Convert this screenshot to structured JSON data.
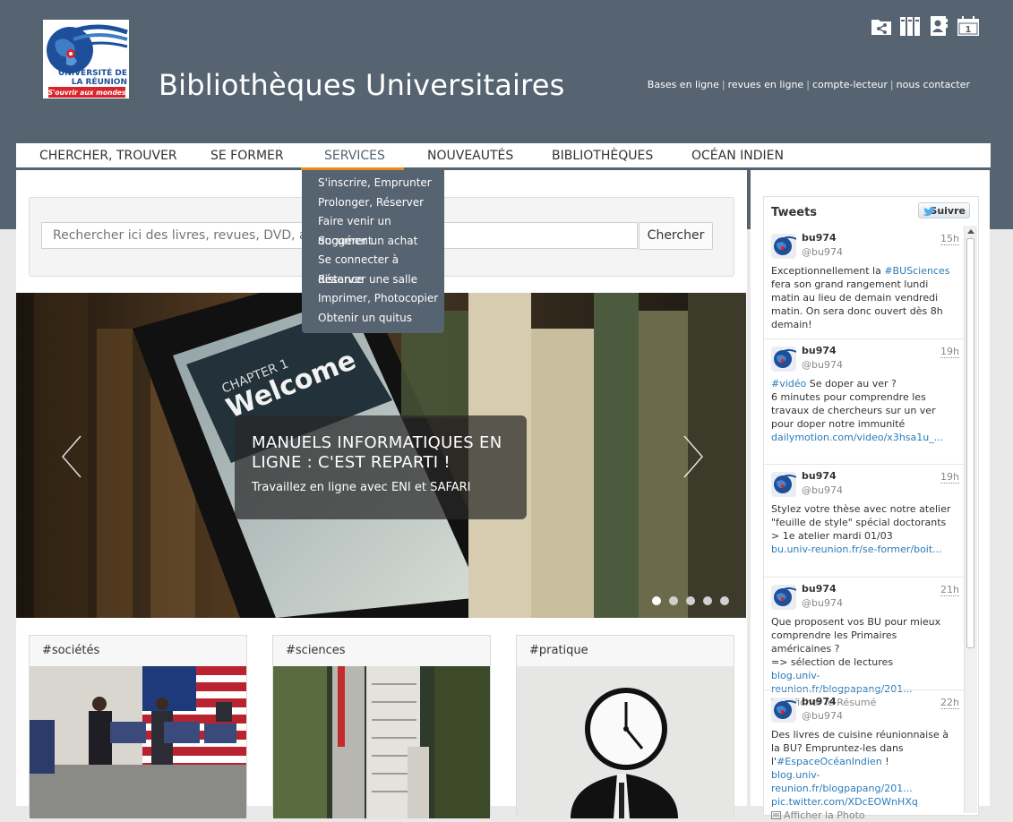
{
  "header": {
    "site_title": "Bibliothèques Universitaires",
    "logo_text_1": "UNIVERSITÉ DE",
    "logo_text_2": "LA RÉUNION",
    "logo_tagline": "S'ouvrir aux mondes",
    "top_links": [
      "Bases en ligne",
      "revues en ligne",
      "compte-lecteur",
      "nous contacter"
    ],
    "top_icons": [
      "folder-share-icon",
      "books-icon",
      "user-card-icon",
      "calendar-icon"
    ],
    "calendar_day": "1"
  },
  "nav": {
    "items": [
      "CHERCHER, TROUVER",
      "SE FORMER",
      "SERVICES",
      "NOUVEAUTÉS",
      "BIBLIOTHÈQUES",
      "OCÉAN INDIEN"
    ],
    "active": "SERVICES",
    "dropdown": [
      "S'inscrire, Emprunter",
      "Prolonger, Réserver",
      "Faire venir un document",
      "Suggérer un achat",
      "Se connecter à distance",
      "Réserver une salle",
      "Imprimer, Photocopier",
      "Obtenir un quitus"
    ]
  },
  "search": {
    "placeholder": "Rechercher ici des livres, revues, DVD, ann",
    "button": "Chercher"
  },
  "slider": {
    "title": "MANUELS INFORMATIQUES EN LIGNE : C'EST REPARTI !",
    "subtitle": "Travaillez en ligne avec ENI et SAFARI",
    "slide_count": 5,
    "active_index": 0,
    "image_text_1": "CHAPTER 1",
    "image_text_2": "Welcome"
  },
  "cards": [
    {
      "tag": "#sociétés"
    },
    {
      "tag": "#sciences"
    },
    {
      "tag": "#pratique"
    }
  ],
  "tweets": {
    "title": "Tweets",
    "follow": "Suivre",
    "items": [
      {
        "user": "bu974",
        "handle": "@bu974",
        "time": "15h",
        "parts": [
          [
            "Exceptionnellement la ",
            ""
          ],
          [
            "#BUSciences",
            "lnk"
          ],
          [
            " fera son grand rangement lundi matin au lieu de demain vendredi matin. On sera donc ouvert dès 8h demain!",
            ""
          ]
        ]
      },
      {
        "user": "bu974",
        "handle": "@bu974",
        "time": "19h",
        "parts": [
          [
            "#vidéo",
            "lnk"
          ],
          [
            " Se doper au ver ?\n6 minutes pour comprendre les travaux de chercheurs sur un ver pour doper notre immunité\n",
            ""
          ],
          [
            "dailymotion.com/video/x3hsa1u_...",
            "lnk"
          ]
        ]
      },
      {
        "user": "bu974",
        "handle": "@bu974",
        "time": "19h",
        "parts": [
          [
            "Stylez votre thèse avec notre atelier \"feuille de style\" spécial doctorants\n> 1e atelier mardi 01/03\n",
            ""
          ],
          [
            "bu.univ-reunion.fr/se-former/boit...",
            "lnk"
          ]
        ]
      },
      {
        "user": "bu974",
        "handle": "@bu974",
        "time": "21h",
        "parts": [
          [
            "Que proposent vos BU pour mieux comprendre les Primaires américaines ?\n=> sélection de lectures\n",
            ""
          ],
          [
            "blog.univ-reunion.fr/blogpapang/201...",
            "lnk"
          ]
        ],
        "action": "Afficher le Résumé"
      },
      {
        "user": "bu974",
        "handle": "@bu974",
        "time": "22h",
        "parts": [
          [
            "Des livres de cuisine réunionnaise à la BU? Empruntez-les dans l'",
            ""
          ],
          [
            "#EspaceOcéanIndien",
            "lnk"
          ],
          [
            " !\n",
            ""
          ],
          [
            "blog.univ-reunion.fr/blogpapang/201...",
            "lnk"
          ],
          [
            "\n",
            ""
          ],
          [
            "pic.twitter.com/XDcEOWnHXq",
            "lnk"
          ]
        ],
        "action": "Afficher la Photo"
      }
    ]
  }
}
